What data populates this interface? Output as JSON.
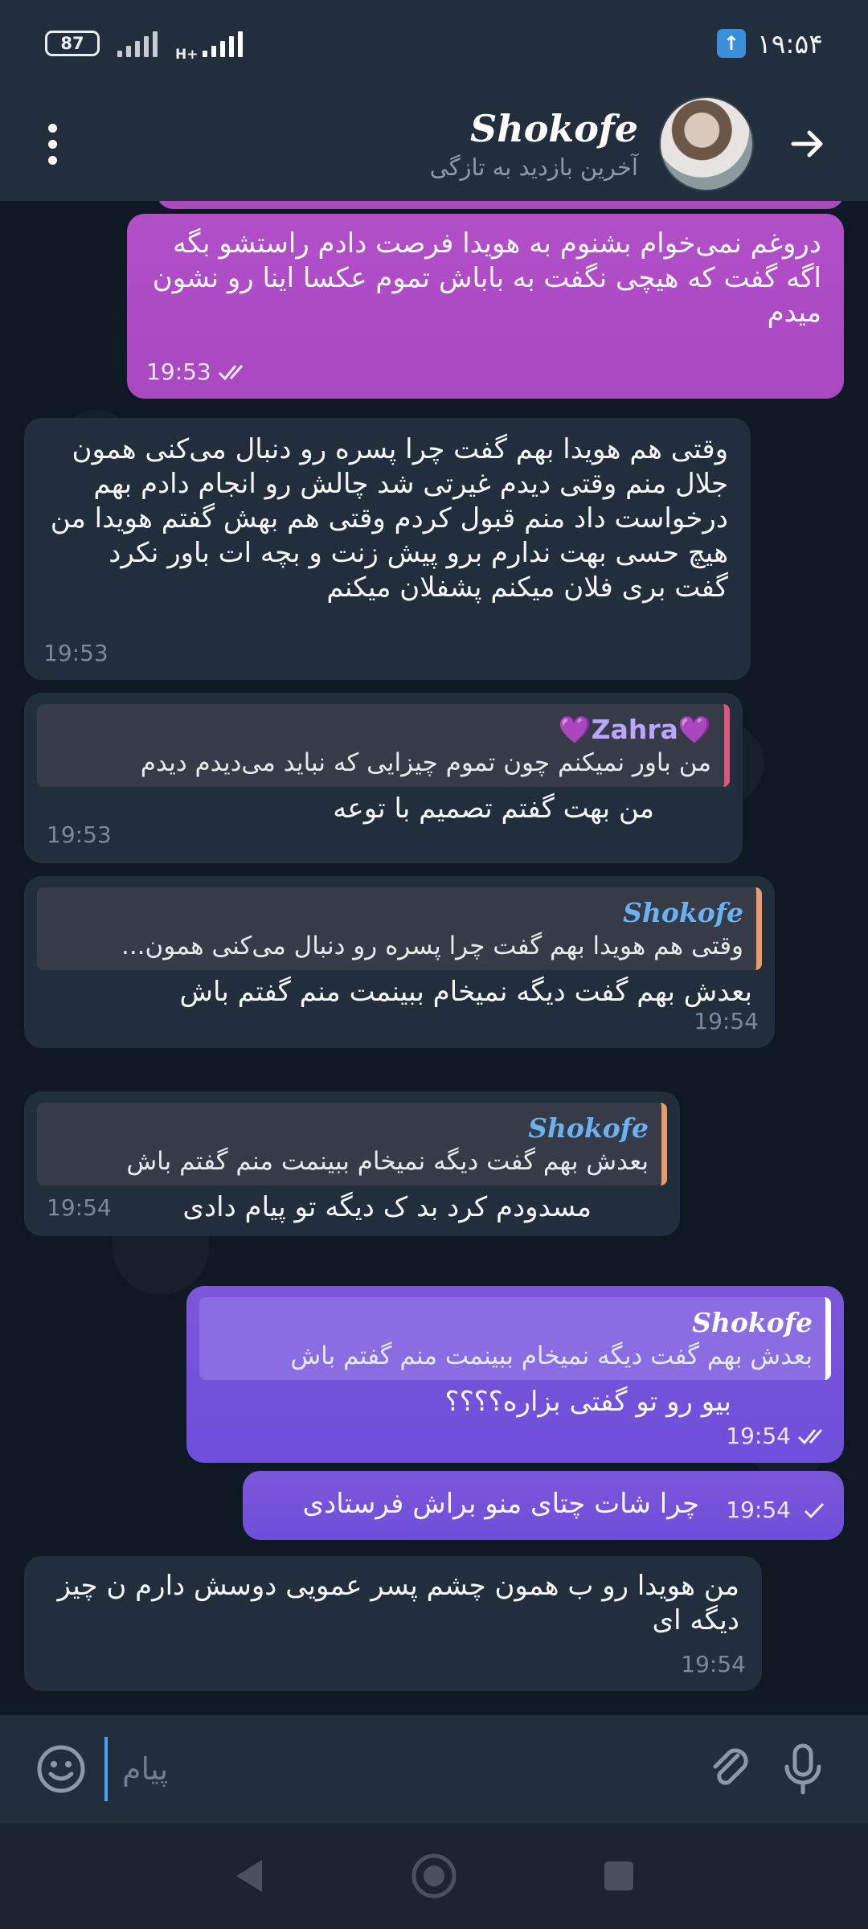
{
  "status_bar": {
    "battery": "87",
    "network": "H+",
    "time": "۱۹:۵۴"
  },
  "header": {
    "title": "Shokofe",
    "subtitle": "آخرین بازدید به تازگی"
  },
  "messages": [
    {
      "dir": "out",
      "text": "دروغم نمی‌خوام بشنوم به هویدا فرصت دادم راستشو بگه اگه گفت که هیچی نگفت به باباش تموم عکسا اینا رو نشون میدم",
      "time": "19:53",
      "status": "read"
    },
    {
      "dir": "in",
      "text": "وقتی هم هویدا بهم گفت چرا پسره رو دنبال می‌کنی همون جلال منم وقتی دیدم غیرتی شد چالش رو انجام دادم بهم درخواست داد منم قبول کردم وقتی هم بهش گفتم هویدا من هیچ حسی بهت ندارم برو پیش زنت و بچه ات باور نکرد گفت بری فلان میکنم پشفلان میکنم",
      "time": "19:53"
    },
    {
      "dir": "in",
      "reply_name": "💜Zahra💜",
      "reply_text": "من باور نمیکنم چون تموم چیزایی که نباید می‌دیدم دیدم",
      "text": "من بهت گفتم تصمیم با توعه",
      "time": "19:53"
    },
    {
      "dir": "in",
      "reply_name": "Shokofe",
      "reply_text": "وقتی هم هویدا بهم گفت چرا پسره رو دنبال می‌کنی همون...",
      "text": "بعدش بهم گفت دیگه نمیخام ببینمت منم گفتم باش",
      "time": "19:54"
    },
    {
      "dir": "in",
      "reply_name": "Shokofe",
      "reply_text": "بعدش بهم گفت دیگه نمیخام ببینمت منم گفتم باش",
      "text": "مسدودم کرد بد ک دیگه تو پیام دادی",
      "time": "19:54"
    },
    {
      "dir": "out",
      "reply_name": "Shokofe",
      "reply_text": "بعدش بهم گفت دیگه نمیخام ببینمت منم گفتم باش",
      "text": "بیو رو تو گفتی بزاره؟؟؟؟",
      "time": "19:54",
      "status": "read"
    },
    {
      "dir": "out",
      "text": "چرا شات چتای منو براش فرستادی",
      "time": "19:54",
      "status": "sent"
    },
    {
      "dir": "in",
      "text": "من هویدا رو ب همون چشم پسر عمویی دوسش دارم ن چیز دیگه ای",
      "time": "19:54"
    }
  ],
  "input": {
    "placeholder": "پیام"
  },
  "colors": {
    "out_pink": "#b14fc9",
    "out_purple": "#7453db",
    "in_bubble": "#222e3b",
    "accent": "#4aa3f0"
  },
  "icons": [
    "more-vert-icon",
    "back-arrow-icon",
    "emoji-icon",
    "attach-icon",
    "mic-icon",
    "upload-icon",
    "nav-back-icon",
    "nav-home-icon",
    "nav-recents-icon"
  ]
}
